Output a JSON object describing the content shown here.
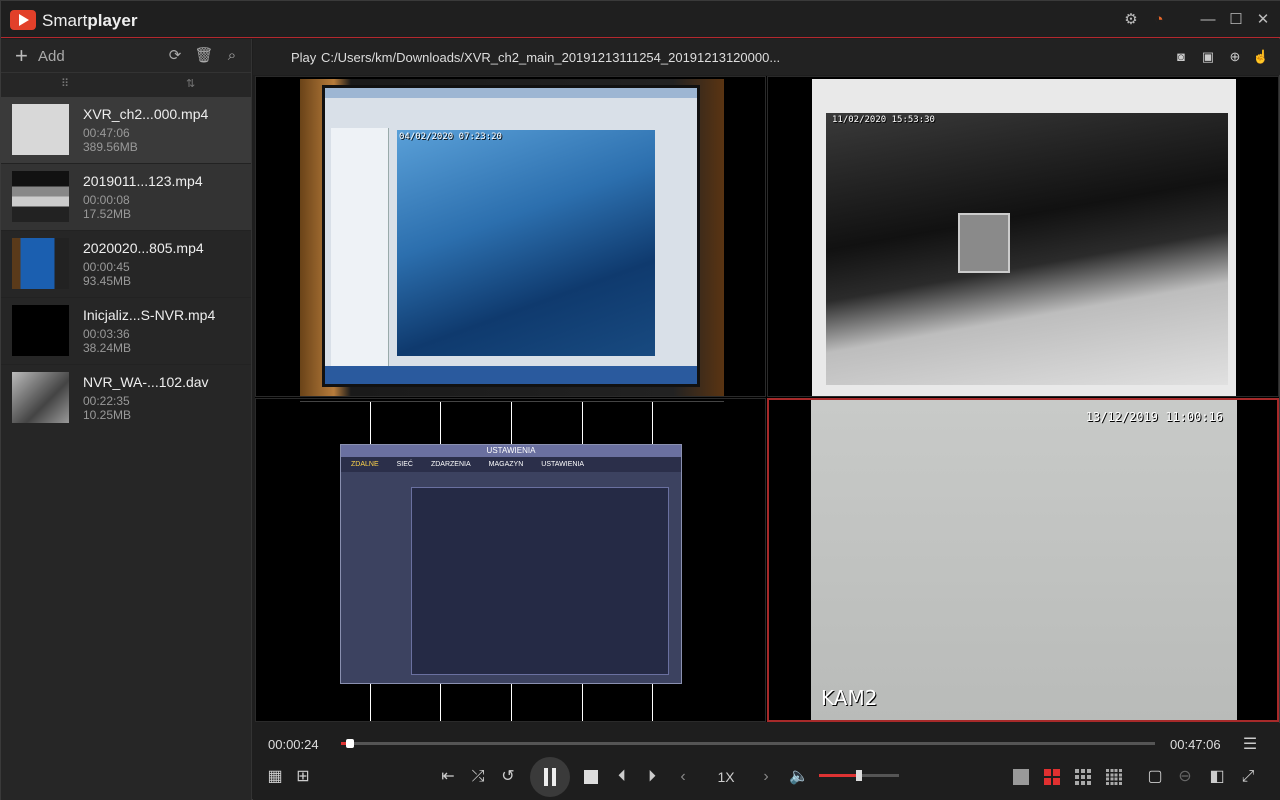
{
  "app": {
    "name_plain": "Smart",
    "name_bold": "player"
  },
  "sidebar": {
    "add_label": "Add",
    "files": [
      {
        "name": "XVR_ch2...000.mp4",
        "duration": "00:47:06",
        "size": "389.56MB"
      },
      {
        "name": "2019011...123.mp4",
        "duration": "00:00:08",
        "size": "17.52MB"
      },
      {
        "name": "2020020...805.mp4",
        "duration": "00:00:45",
        "size": "93.45MB"
      },
      {
        "name": "Inicjaliz...S-NVR.mp4",
        "duration": "00:03:36",
        "size": "38.24MB"
      },
      {
        "name": "NVR_WA-...102.dav",
        "duration": "00:22:35",
        "size": "10.25MB"
      }
    ]
  },
  "pathbar": {
    "play_label": "Play",
    "path": "C:/Users/km/Downloads/XVR_ch2_main_20191213111254_20191213120000..."
  },
  "video": {
    "cam1_stamp": "04/02/2020 07:23:20",
    "cam2_stamp": "11/02/2020 15:53:30",
    "cam4_stamp": "13/12/2019 11:00:16",
    "cam4_label": "KAM2",
    "dvr_title": "USTAWIENIA",
    "dvr_tabs": [
      "ZDALNE",
      "SIEĆ",
      "ZDARZENIA",
      "MAGAZYN",
      "USTAWIENIA"
    ]
  },
  "controls": {
    "current_time": "00:00:24",
    "total_time": "00:47:06",
    "progress": 0.0085,
    "speed": "1X",
    "volume": 0.5
  },
  "colors": {
    "accent": "#d33333",
    "active_border": "#a72a2a"
  },
  "icons": [
    "settings-icon",
    "record-icon",
    "minimize-icon",
    "maximize-icon",
    "close-icon",
    "refresh-icon",
    "trash-icon",
    "search-icon",
    "snapshot-icon",
    "clip-icon",
    "zoom-icon",
    "pin-icon"
  ]
}
